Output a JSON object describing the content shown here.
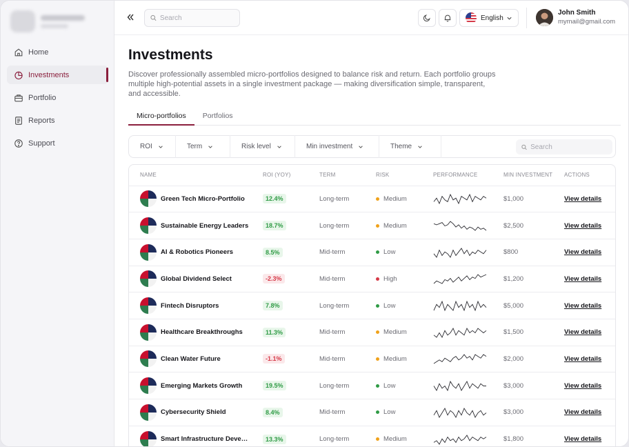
{
  "app": {
    "window": "Investments dashboard"
  },
  "sidebar": {
    "items": [
      {
        "label": "Home",
        "icon": "home-icon",
        "active": false
      },
      {
        "label": "Investments",
        "icon": "pie-chart-icon",
        "active": true
      },
      {
        "label": "Portfolio",
        "icon": "briefcase-icon",
        "active": false
      },
      {
        "label": "Reports",
        "icon": "document-icon",
        "active": false
      },
      {
        "label": "Support",
        "icon": "help-circle-icon",
        "active": false
      }
    ]
  },
  "header": {
    "search_placeholder": "Search",
    "language": "English",
    "user": {
      "name": "John Smith",
      "email": "mymail@gmail.com"
    }
  },
  "page": {
    "title": "Investments",
    "description": "Discover professionally assembled micro-portfolios designed to balance risk and return. Each portfolio groups multiple high-potential assets in a single investment package — making diversification simple, transparent, and accessible."
  },
  "tabs": [
    {
      "label": "Micro-portfolios",
      "active": true
    },
    {
      "label": "Portfolios",
      "active": false
    }
  ],
  "filters": {
    "items": [
      "ROI",
      "Term",
      "Risk level",
      "Min investment",
      "Theme"
    ],
    "search_placeholder": "Search"
  },
  "table": {
    "columns": [
      "NAME",
      "ROI (YOY)",
      "TERM",
      "RISK",
      "PERFORMANCE",
      "MIN INVESTMENT",
      "ACTIONS"
    ],
    "rows": [
      {
        "name": "Green Tech Micro-Portfolio",
        "roi": "12.4%",
        "roi_sign": "pos",
        "term": "Long-term",
        "risk": "Medium",
        "min": "$1,000",
        "action": "View details",
        "spark": [
          6,
          8,
          5,
          9,
          7,
          6,
          10,
          7,
          8,
          5,
          9,
          8,
          7,
          10,
          6,
          9,
          8,
          7,
          9,
          8
        ]
      },
      {
        "name": "Sustainable Energy Leaders",
        "roi": "18.7%",
        "roi_sign": "pos",
        "term": "Long-term",
        "risk": "Medium",
        "min": "$2,500",
        "action": "View details",
        "spark": [
          12,
          11,
          12,
          13,
          10,
          11,
          14,
          12,
          9,
          11,
          8,
          10,
          7,
          9,
          8,
          6,
          9,
          7,
          8,
          6
        ]
      },
      {
        "name": "AI & Robotics Pioneers",
        "roi": "8.5%",
        "roi_sign": "pos",
        "term": "Mid-term",
        "risk": "Low",
        "min": "$800",
        "action": "View details",
        "spark": [
          7,
          5,
          9,
          6,
          8,
          7,
          5,
          9,
          6,
          8,
          10,
          7,
          9,
          6,
          8,
          7,
          9,
          8,
          7,
          9
        ]
      },
      {
        "name": "Global Dividend Select",
        "roi": "-2.3%",
        "roi_sign": "neg",
        "term": "Mid-term",
        "risk": "High",
        "min": "$1,200",
        "action": "View details",
        "spark": [
          5,
          7,
          6,
          5,
          8,
          7,
          9,
          6,
          8,
          10,
          7,
          9,
          11,
          8,
          10,
          9,
          12,
          10,
          11,
          12
        ]
      },
      {
        "name": "Fintech Disruptors",
        "roi": "7.8%",
        "roi_sign": "pos",
        "term": "Long-term",
        "risk": "Low",
        "min": "$5,000",
        "action": "View details",
        "spark": [
          6,
          8,
          7,
          9,
          6,
          8,
          7,
          6,
          9,
          7,
          8,
          6,
          9,
          7,
          8,
          6,
          9,
          7,
          8,
          7
        ]
      },
      {
        "name": "Healthcare Breakthroughs",
        "roi": "11.3%",
        "roi_sign": "pos",
        "term": "Mid-term",
        "risk": "Medium",
        "min": "$1,500",
        "action": "View details",
        "spark": [
          7,
          6,
          8,
          6,
          9,
          7,
          8,
          10,
          7,
          9,
          8,
          7,
          10,
          8,
          9,
          8,
          10,
          9,
          8,
          9
        ]
      },
      {
        "name": "Clean Water Future",
        "roi": "-1.1%",
        "roi_sign": "neg",
        "term": "Mid-term",
        "risk": "Medium",
        "min": "$2,000",
        "action": "View details",
        "spark": [
          5,
          6,
          7,
          6,
          8,
          7,
          6,
          8,
          9,
          7,
          8,
          10,
          8,
          9,
          7,
          10,
          9,
          8,
          10,
          9
        ]
      },
      {
        "name": "Emerging Markets Growth",
        "roi": "19.5%",
        "roi_sign": "pos",
        "term": "Long-term",
        "risk": "Low",
        "min": "$3,000",
        "action": "View details",
        "spark": [
          8,
          6,
          9,
          7,
          8,
          6,
          10,
          8,
          7,
          9,
          6,
          8,
          10,
          7,
          9,
          8,
          7,
          9,
          8,
          8
        ]
      },
      {
        "name": "Cybersecurity Shield",
        "roi": "8.4%",
        "roi_sign": "pos",
        "term": "Mid-term",
        "risk": "Low",
        "min": "$3,000",
        "action": "View details",
        "spark": [
          7,
          9,
          6,
          8,
          10,
          7,
          9,
          8,
          6,
          9,
          7,
          10,
          8,
          7,
          9,
          6,
          8,
          9,
          7,
          8
        ]
      },
      {
        "name": "Smart Infrastructure Develo...",
        "roi": "13.3%",
        "roi_sign": "pos",
        "term": "Long-term",
        "risk": "Medium",
        "min": "$1,800",
        "action": "View details",
        "spark": [
          6,
          7,
          5,
          8,
          6,
          9,
          7,
          8,
          6,
          9,
          7,
          8,
          10,
          7,
          9,
          8,
          7,
          9,
          8,
          9
        ]
      }
    ]
  },
  "colors": {
    "accent": "#8a1e3c",
    "risk_low": "#2f9b45",
    "risk_medium": "#f0a21b",
    "risk_high": "#d63a48"
  }
}
